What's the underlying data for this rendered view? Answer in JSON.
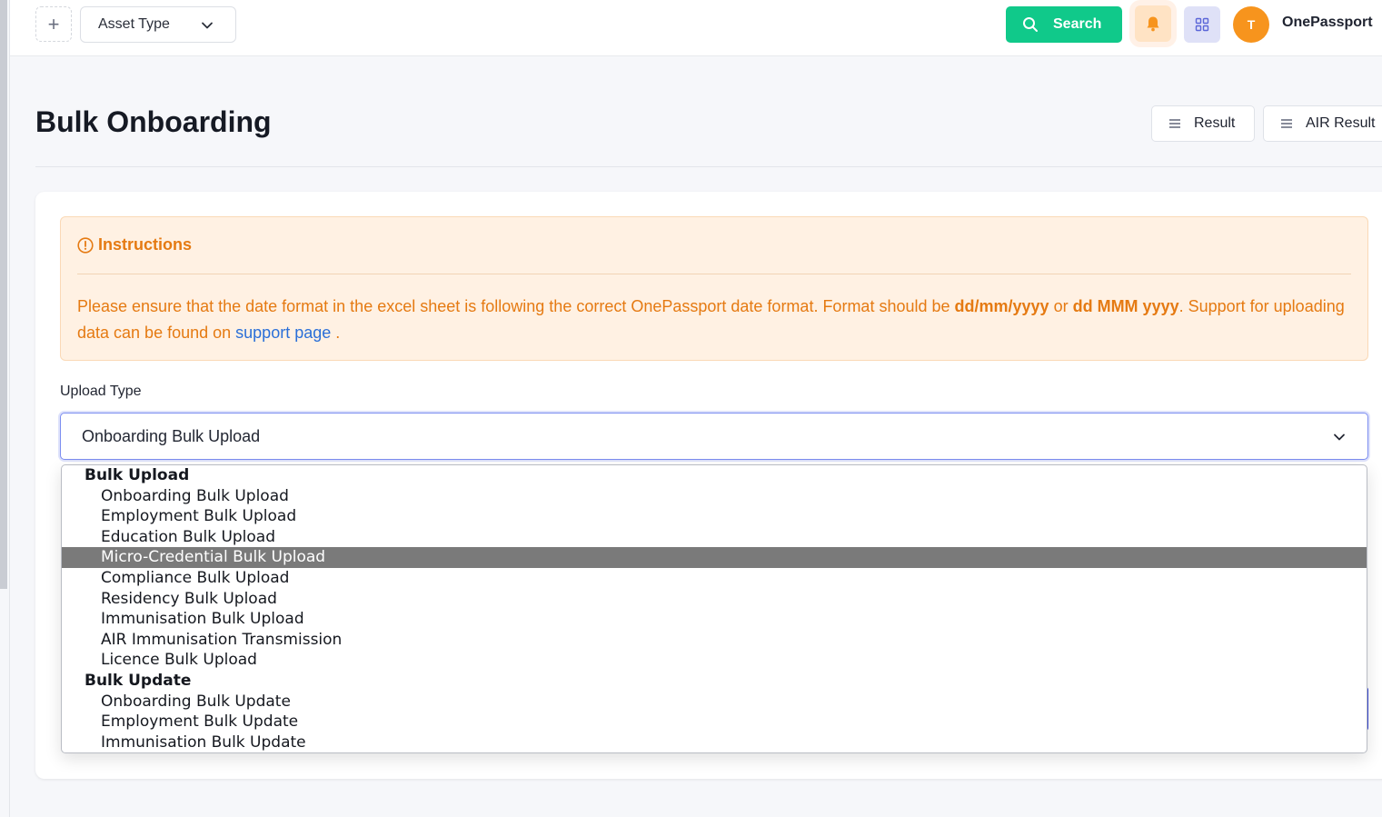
{
  "topbar": {
    "asset_type_label": "Asset Type",
    "search_label": "Search",
    "avatar_initial": "T",
    "brand": "OnePassport"
  },
  "header": {
    "title": "Bulk Onboarding",
    "result_label": "Result",
    "air_result_label": "AIR Result"
  },
  "instructions": {
    "heading": "Instructions",
    "text_1": "Please ensure that the date format in the excel sheet is following the correct OnePassport date format. Format should be ",
    "format_1": "dd/mm/yyyy",
    "text_or": " or ",
    "format_2": "dd MMM yyyy",
    "text_2": ". Support for uploading data can be found on ",
    "link": "support page",
    "text_end": " ."
  },
  "upload": {
    "label": "Upload Type",
    "selected": "Onboarding Bulk Upload"
  },
  "dropdown": {
    "groups": [
      {
        "label": "Bulk Upload",
        "options": [
          "Onboarding Bulk Upload",
          "Employment Bulk Upload",
          "Education Bulk Upload",
          "Micro-Credential Bulk Upload",
          "Compliance Bulk Upload",
          "Residency Bulk Upload",
          "Immunisation Bulk Upload",
          "AIR Immunisation Transmission",
          "Licence Bulk Upload"
        ]
      },
      {
        "label": "Bulk Update",
        "options": [
          "Onboarding Bulk Update",
          "Employment Bulk Update",
          "Immunisation Bulk Update"
        ]
      }
    ],
    "highlighted": "Micro-Credential Bulk Upload"
  },
  "colors": {
    "accent_green": "#10c98a",
    "warning_orange": "#e57a12",
    "avatar_orange": "#f7941d",
    "link_blue": "#2a6fd8"
  }
}
